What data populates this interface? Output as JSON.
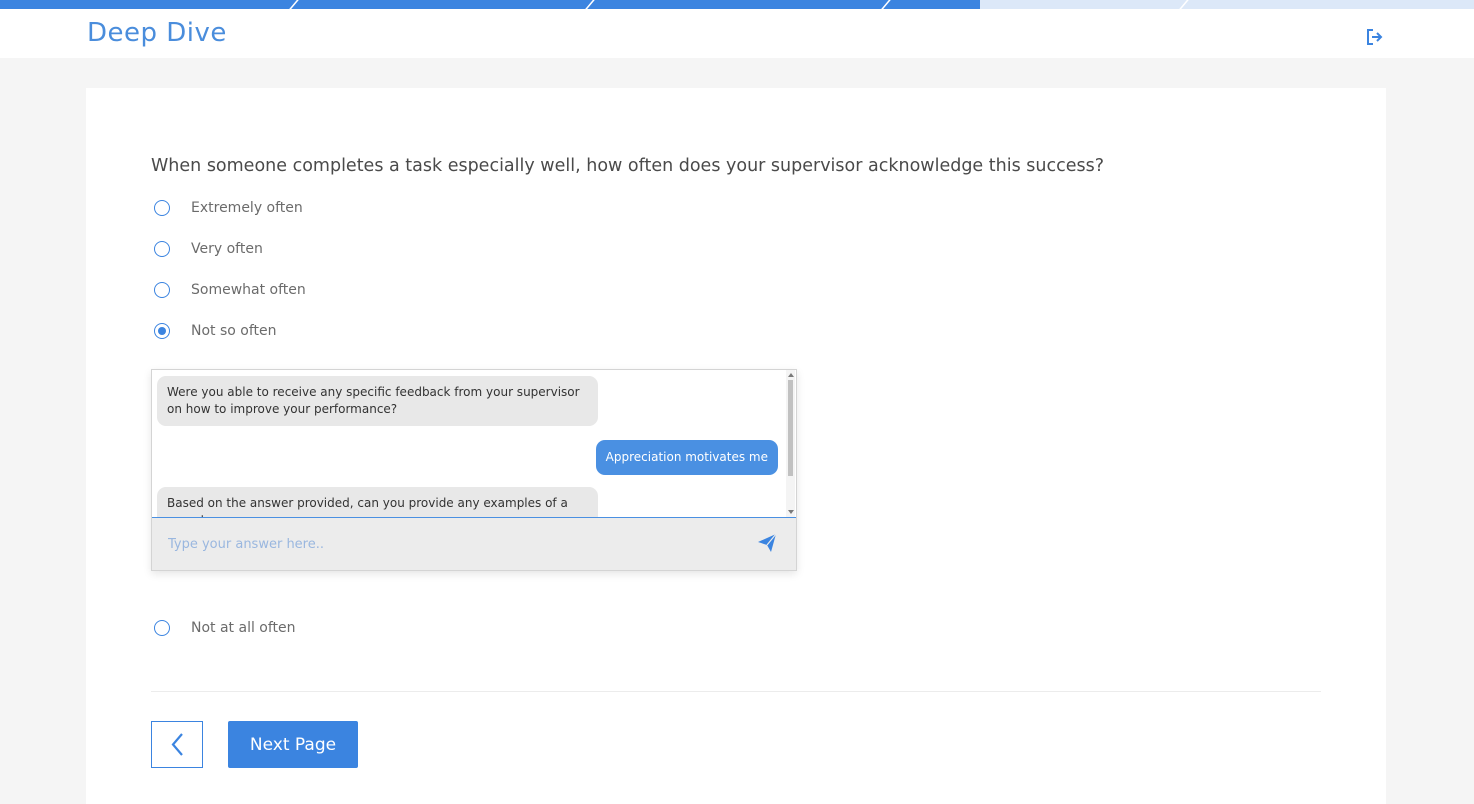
{
  "header": {
    "title": "Deep Dive",
    "logout_icon": "logout-icon"
  },
  "progress": {
    "segments_completed": 3.3,
    "segments_total": 5
  },
  "survey": {
    "question": "When someone completes a task especially well, how often does your supervisor acknowledge this success?",
    "options": [
      {
        "label": "Extremely often",
        "selected": false
      },
      {
        "label": "Very often",
        "selected": false
      },
      {
        "label": "Somewhat often",
        "selected": false
      },
      {
        "label": "Not so often",
        "selected": true
      },
      {
        "label": "Not at all often",
        "selected": false
      }
    ]
  },
  "chat": {
    "messages": [
      {
        "from": "bot",
        "text": "Were you able to receive any specific feedback from your supervisor on how to improve your performance?"
      },
      {
        "from": "user",
        "text": "Appreciation motivates me"
      },
      {
        "from": "bot",
        "text": "Based on the answer provided, can you provide any examples of a recent"
      }
    ],
    "input_placeholder": "Type your answer here..",
    "send_icon": "send-icon"
  },
  "navigation": {
    "back_icon": "chevron-left-icon",
    "next_label": "Next Page"
  },
  "colors": {
    "accent": "#3b84e0",
    "user_bubble": "#4a90e2",
    "bot_bubble": "#e8e8e8",
    "title": "#4a8ddc"
  }
}
